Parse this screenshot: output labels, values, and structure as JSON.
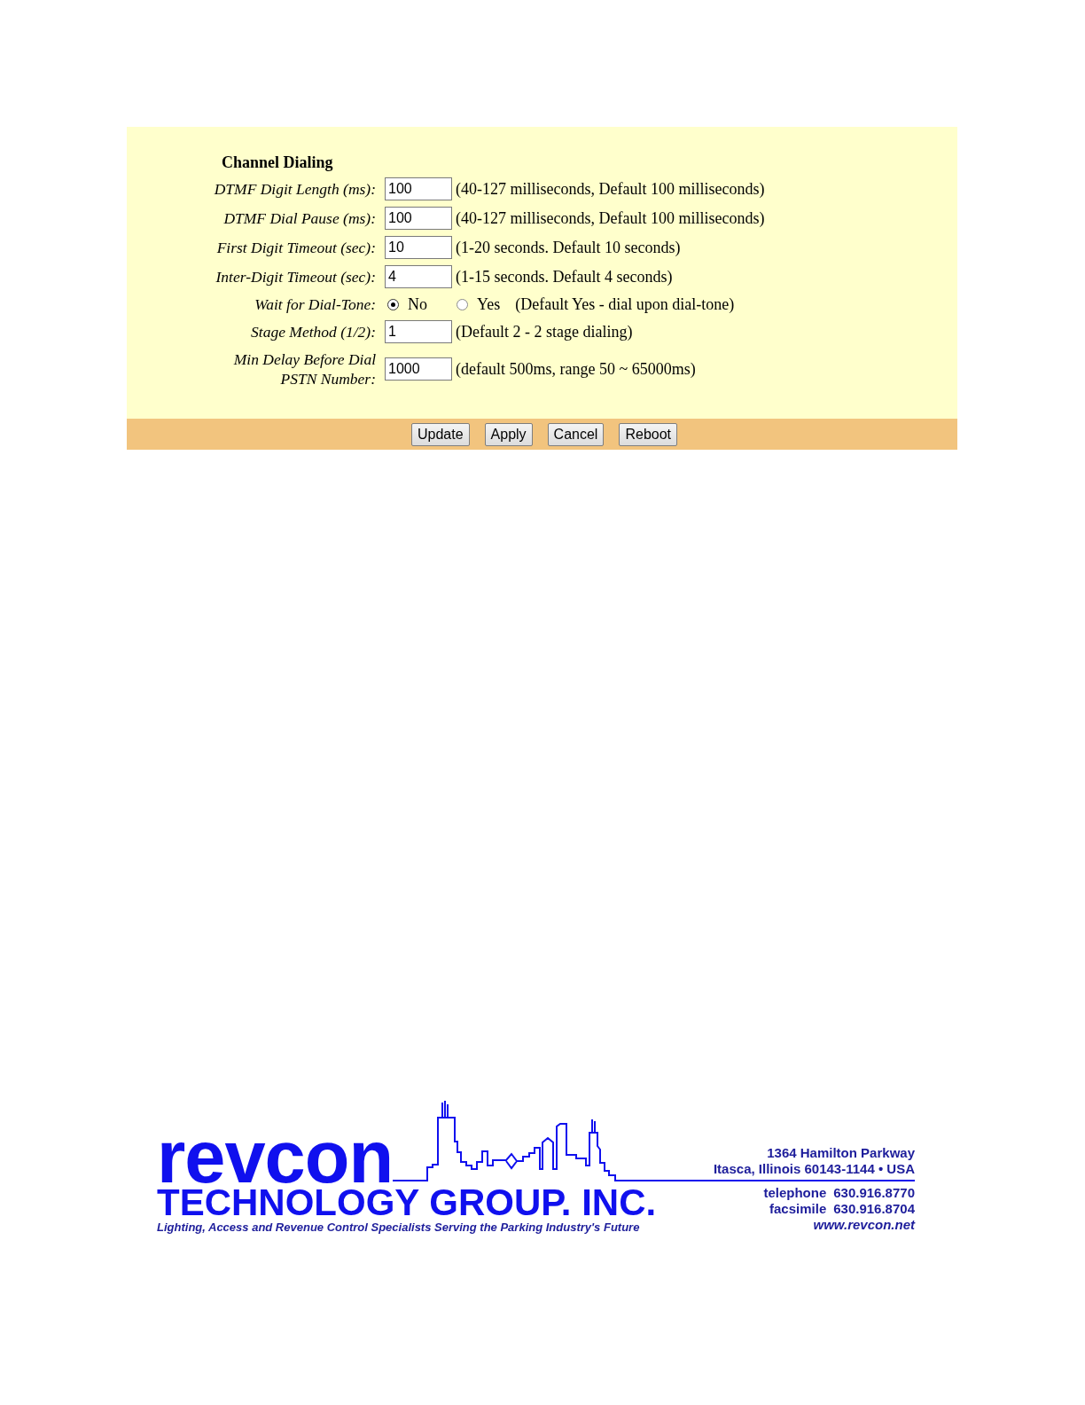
{
  "section_title": "Channel Dialing",
  "settings": [
    {
      "kind": "text",
      "label": "DTMF Digit Length (ms):",
      "value": "100",
      "hint": "(40-127 milliseconds, Default 100 milliseconds)"
    },
    {
      "kind": "text",
      "label": "DTMF Dial Pause (ms):",
      "value": "100",
      "hint": "(40-127 milliseconds, Default 100 milliseconds)"
    },
    {
      "kind": "text",
      "label": "First Digit Timeout (sec):",
      "value": "10",
      "hint": "(1-20 seconds. Default 10 seconds)"
    },
    {
      "kind": "text",
      "label": "Inter-Digit Timeout (sec):",
      "value": "4",
      "hint": "(1-15 seconds. Default 4 seconds)"
    },
    {
      "kind": "radio",
      "label": "Wait for Dial-Tone:",
      "options": [
        {
          "label": "No",
          "selected": true
        },
        {
          "label": "Yes",
          "selected": false
        }
      ],
      "hint": "(Default Yes - dial upon dial-tone)"
    },
    {
      "kind": "text",
      "label": "Stage Method (1/2):",
      "value": "1",
      "hint": "(Default 2 - 2 stage dialing)"
    },
    {
      "kind": "text",
      "label": "Min Delay Before Dial PSTN Number:",
      "value": "1000",
      "hint": "(default 500ms, range 50 ~ 65000ms)"
    }
  ],
  "buttons": [
    "Update",
    "Apply",
    "Cancel",
    "Reboot"
  ],
  "footer": {
    "logo_name": "revcon",
    "company": "TECHNOLOGY GROUP. INC.",
    "tagline": "Lighting, Access and Revenue Control Specialists Serving the Parking Industry's Future",
    "address": [
      "1364 Hamilton Parkway",
      "Itasca, Illinois 60143-1144 • USA"
    ],
    "contacts": [
      {
        "label": "telephone",
        "number": "630.916.8770"
      },
      {
        "label": "facsimile",
        "number": "630.916.8704"
      }
    ],
    "website": "www.revcon.net"
  }
}
